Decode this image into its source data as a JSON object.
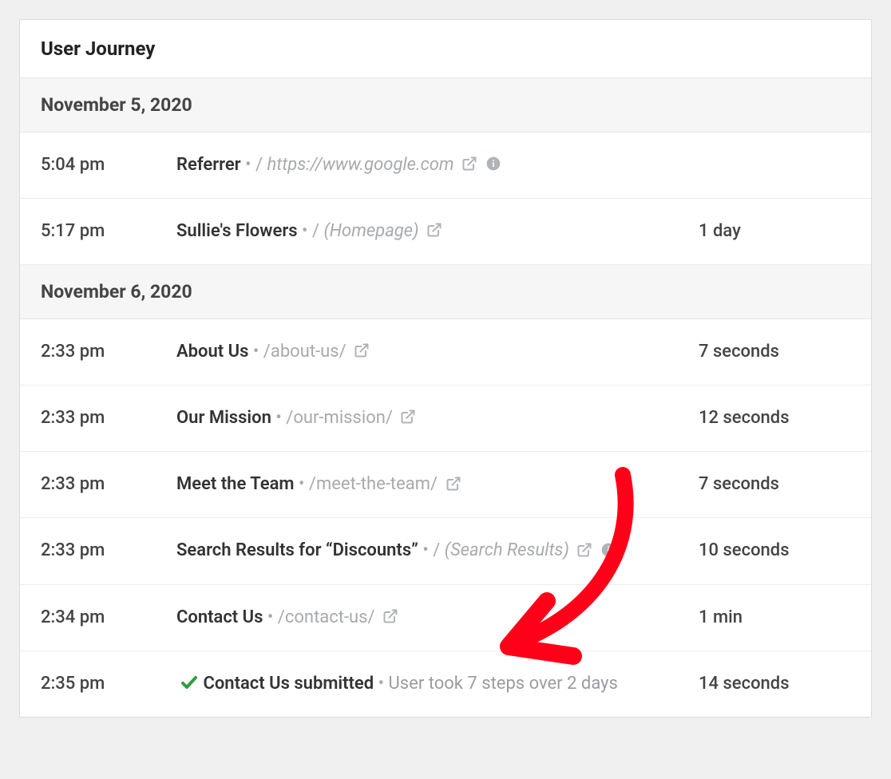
{
  "panel_title": "User Journey",
  "days": [
    {
      "date": "November 5, 2020",
      "rows": [
        {
          "time": "5:04 pm",
          "title": "Referrer",
          "path_prefix": "/ ",
          "path": "https://www.google.com",
          "path_italic": true,
          "show_info": true,
          "duration": ""
        },
        {
          "time": "5:17 pm",
          "title": "Sullie's Flowers",
          "path_prefix": "/ ",
          "path": "(Homepage)",
          "path_italic": true,
          "duration": "1 day"
        }
      ]
    },
    {
      "date": "November 6, 2020",
      "rows": [
        {
          "time": "2:33 pm",
          "title": "About Us",
          "path_prefix": "",
          "path": "/about-us/",
          "duration": "7 seconds"
        },
        {
          "time": "2:33 pm",
          "title": "Our Mission",
          "path_prefix": "",
          "path": "/our-mission/",
          "duration": "12 seconds"
        },
        {
          "time": "2:33 pm",
          "title": "Meet the Team",
          "path_prefix": "",
          "path": "/meet-the-team/",
          "duration": "7 seconds"
        },
        {
          "time": "2:33 pm",
          "title": "Search Results for “Discounts”",
          "path_prefix": "/ ",
          "path": "(Search Results)",
          "path_italic": true,
          "show_info": true,
          "duration": "10 seconds"
        },
        {
          "time": "2:34 pm",
          "title": "Contact Us",
          "path_prefix": "",
          "path": "/contact-us/",
          "duration": "1 min"
        },
        {
          "time": "2:35 pm",
          "check": true,
          "title": "Contact Us submitted",
          "subtext": "User took 7 steps over 2 days",
          "no_link": true,
          "duration": "14 seconds"
        }
      ]
    }
  ],
  "annotation": {
    "type": "curved-arrow",
    "color": "#ff0019"
  }
}
